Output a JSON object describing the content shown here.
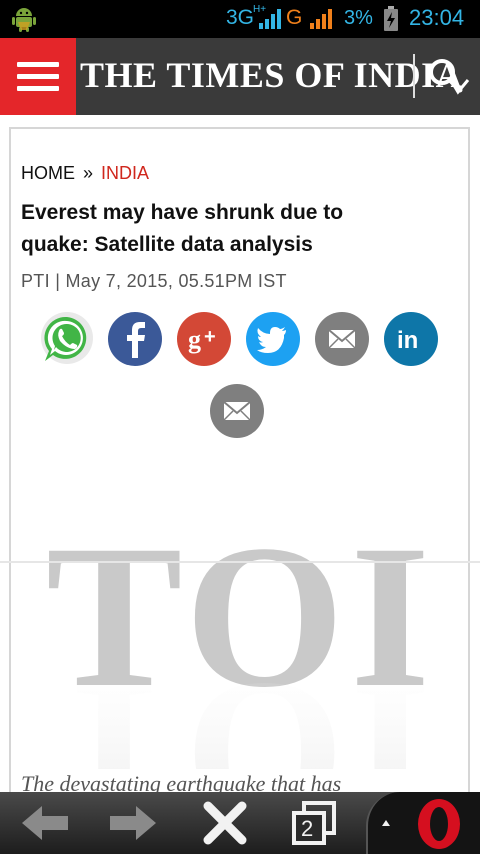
{
  "status_bar": {
    "network_1": "3G",
    "network_1_sup": "H+",
    "network_2": "G",
    "battery_percent": "3%",
    "time": "23:04",
    "accent_color": "#33b5e5",
    "network_2_color": "#f0801b"
  },
  "header": {
    "masthead": "THE TIMES OF INDIA",
    "brand_color": "#e4262a"
  },
  "article": {
    "breadcrumb": {
      "home": "HOME",
      "separator": "»",
      "current": "INDIA"
    },
    "headline": "Everest may have shrunk due to quake: Satellite data analysis",
    "byline": "PTI | May 7, 2015, 05.51PM IST",
    "share_icons": [
      "whatsapp-icon",
      "facebook-icon",
      "google-plus-icon",
      "twitter-icon",
      "email-icon",
      "linkedin-icon",
      "email-icon"
    ],
    "image_text": "TOI",
    "body_start": "The devastating earthquake that has"
  },
  "toolbar": {
    "tab_count": "2",
    "icons": [
      "back-arrow-icon",
      "forward-arrow-icon",
      "close-icon",
      "tabs-icon",
      "opera-menu-icon"
    ]
  }
}
